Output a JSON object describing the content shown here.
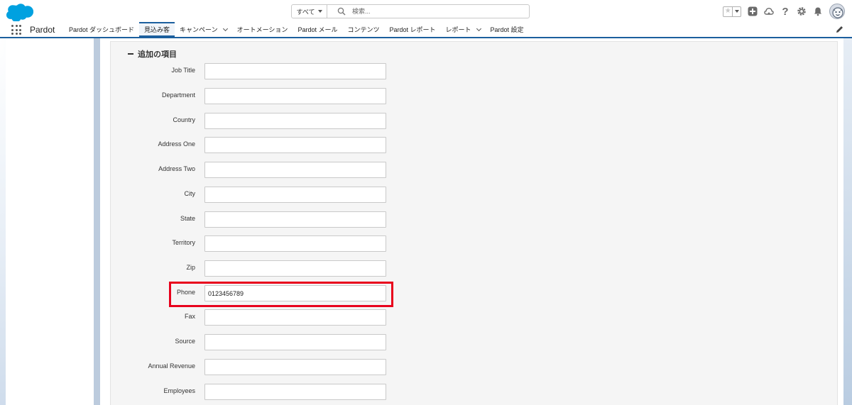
{
  "header": {
    "search_scope": "すべて",
    "search_placeholder": "検索...",
    "favorite_star": "★"
  },
  "nav": {
    "app_name": "Pardot",
    "tabs": [
      {
        "label": "Pardot ダッシュボード",
        "active": false,
        "dropdown": false
      },
      {
        "label": "見込み客",
        "active": true,
        "dropdown": false
      },
      {
        "label": "キャンペーン",
        "active": false,
        "dropdown": true
      },
      {
        "label": "オートメーション",
        "active": false,
        "dropdown": false
      },
      {
        "label": "Pardot メール",
        "active": false,
        "dropdown": false
      },
      {
        "label": "コンテンツ",
        "active": false,
        "dropdown": false
      },
      {
        "label": "Pardot レポート",
        "active": false,
        "dropdown": false
      },
      {
        "label": "レポート",
        "active": false,
        "dropdown": true
      },
      {
        "label": "Pardot 設定",
        "active": false,
        "dropdown": false
      }
    ]
  },
  "section": {
    "title": "追加の項目",
    "fields": [
      {
        "label": "Job Title",
        "value": ""
      },
      {
        "label": "Department",
        "value": ""
      },
      {
        "label": "Country",
        "value": ""
      },
      {
        "label": "Address One",
        "value": ""
      },
      {
        "label": "Address Two",
        "value": ""
      },
      {
        "label": "City",
        "value": ""
      },
      {
        "label": "State",
        "value": ""
      },
      {
        "label": "Territory",
        "value": ""
      },
      {
        "label": "Zip",
        "value": ""
      },
      {
        "label": "Phone",
        "value": "0123456789"
      },
      {
        "label": "Fax",
        "value": ""
      },
      {
        "label": "Source",
        "value": ""
      },
      {
        "label": "Annual Revenue",
        "value": ""
      },
      {
        "label": "Employees",
        "value": ""
      }
    ]
  },
  "colors": {
    "brand_blue": "#1b5f9e",
    "salesforce_cloud": "#00a1e0",
    "highlight_red": "#e8001c"
  },
  "icons": [
    "app-launcher-icon",
    "salesforce-logo",
    "search-icon",
    "star-icon",
    "add-icon",
    "trailhead-icon",
    "help-icon",
    "settings-icon",
    "notification-bell-icon",
    "edit-pencil-icon",
    "collapse-minus-icon"
  ]
}
